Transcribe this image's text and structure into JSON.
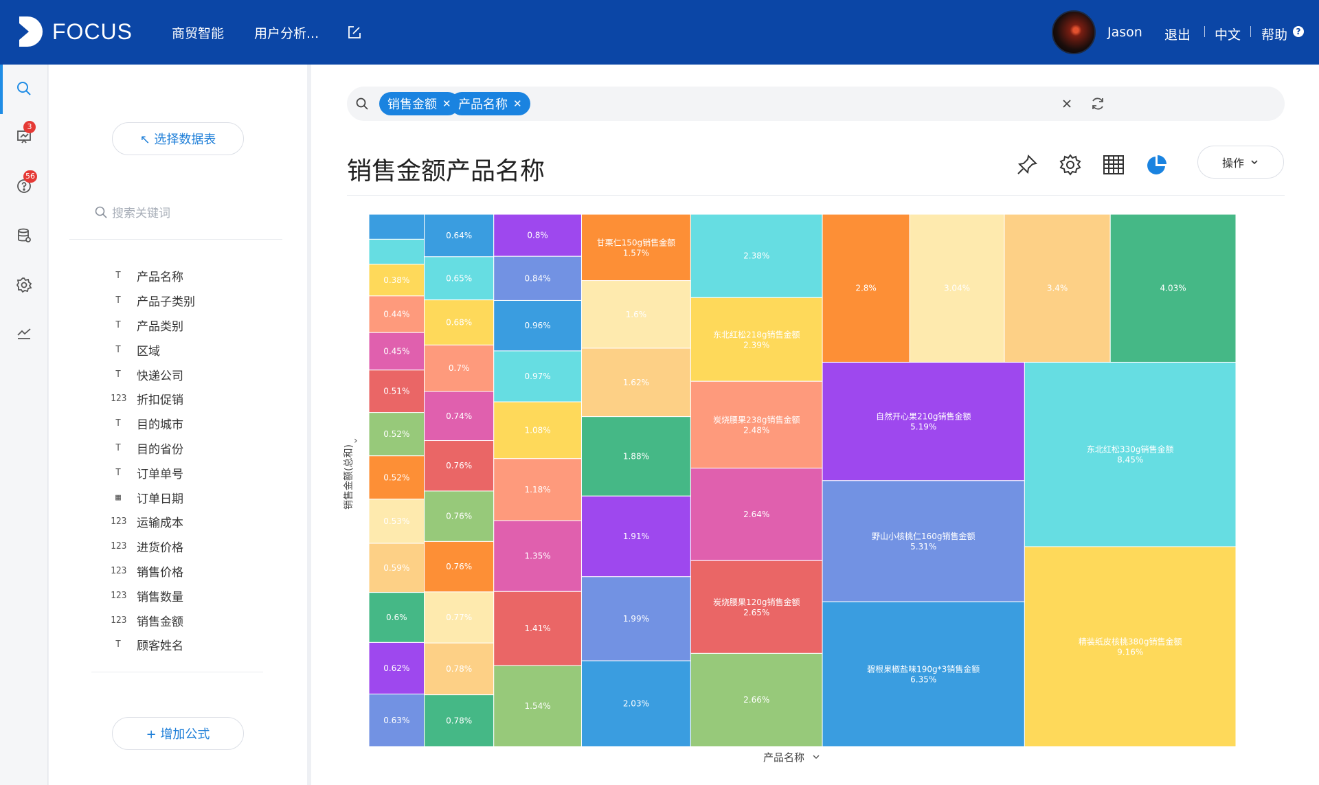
{
  "app": {
    "brand": "FOCUS"
  },
  "nav": {
    "items": [
      "商贸智能",
      "用户分析..."
    ]
  },
  "user": {
    "name": "Jason",
    "logout": "退出",
    "language": "中文",
    "help": "帮助"
  },
  "rail": {
    "badges": {
      "reports": "3",
      "questions": "56"
    }
  },
  "panel": {
    "select_table": "↖ 选择数据表",
    "search_placeholder": "搜索关键词",
    "add_formula": "+ 增加公式",
    "fields": [
      {
        "name": "产品名称",
        "type": "text"
      },
      {
        "name": "产品子类别",
        "type": "text"
      },
      {
        "name": "产品类别",
        "type": "text"
      },
      {
        "name": "区域",
        "type": "text"
      },
      {
        "name": "快递公司",
        "type": "text"
      },
      {
        "name": "折扣促销",
        "type": "number"
      },
      {
        "name": "目的城市",
        "type": "text"
      },
      {
        "name": "目的省份",
        "type": "text"
      },
      {
        "name": "订单单号",
        "type": "text"
      },
      {
        "name": "订单日期",
        "type": "date"
      },
      {
        "name": "运输成本",
        "type": "number"
      },
      {
        "name": "进货价格",
        "type": "number"
      },
      {
        "name": "销售价格",
        "type": "number"
      },
      {
        "name": "销售数量",
        "type": "number"
      },
      {
        "name": "销售金额",
        "type": "number"
      },
      {
        "name": "顾客姓名",
        "type": "text"
      }
    ]
  },
  "search": {
    "tokens": [
      "销售金额",
      "产品名称"
    ]
  },
  "main": {
    "title": "销售金额产品名称",
    "ops_label": "操作"
  },
  "chart_data": {
    "type": "treemap",
    "ylabel": "销售金额(总和)",
    "xlabel": "产品名称",
    "columns": [
      {
        "items": [
          {
            "label": "",
            "value": "",
            "color": "#3a9de0"
          },
          {
            "label": "",
            "value": "",
            "color": "#66dde2"
          },
          {
            "label": "",
            "value": "0.38%",
            "color": "#fed95a"
          },
          {
            "label": "",
            "value": "0.44%",
            "color": "#fe9a7c"
          },
          {
            "label": "",
            "value": "0.45%",
            "color": "#e060ae"
          },
          {
            "label": "",
            "value": "0.51%",
            "color": "#ea6666"
          },
          {
            "label": "",
            "value": "0.52%",
            "color": "#97c97a"
          },
          {
            "label": "",
            "value": "0.52%",
            "color": "#fd8f36"
          },
          {
            "label": "",
            "value": "0.53%",
            "color": "#feeaae"
          },
          {
            "label": "",
            "value": "0.59%",
            "color": "#fdd086"
          },
          {
            "label": "",
            "value": "0.6%",
            "color": "#45b886"
          },
          {
            "label": "",
            "value": "0.62%",
            "color": "#9e48ee"
          },
          {
            "label": "",
            "value": "0.63%",
            "color": "#7292e3"
          }
        ]
      },
      {
        "items": [
          {
            "label": "",
            "value": "0.64%",
            "color": "#3a9de0"
          },
          {
            "label": "",
            "value": "0.65%",
            "color": "#66dde2"
          },
          {
            "label": "",
            "value": "0.68%",
            "color": "#fed95a"
          },
          {
            "label": "",
            "value": "0.7%",
            "color": "#fe9a7c"
          },
          {
            "label": "",
            "value": "0.74%",
            "color": "#e060ae"
          },
          {
            "label": "",
            "value": "0.76%",
            "color": "#ea6666"
          },
          {
            "label": "",
            "value": "0.76%",
            "color": "#97c97a"
          },
          {
            "label": "",
            "value": "0.76%",
            "color": "#fd8f36"
          },
          {
            "label": "",
            "value": "0.77%",
            "color": "#feeaae"
          },
          {
            "label": "",
            "value": "0.78%",
            "color": "#fdd086"
          },
          {
            "label": "",
            "value": "0.78%",
            "color": "#45b886"
          }
        ]
      },
      {
        "items": [
          {
            "label": "",
            "value": "0.8%",
            "color": "#9e48ee"
          },
          {
            "label": "",
            "value": "0.84%",
            "color": "#7292e3"
          },
          {
            "label": "",
            "value": "0.96%",
            "color": "#3a9de0"
          },
          {
            "label": "",
            "value": "0.97%",
            "color": "#66dde2"
          },
          {
            "label": "",
            "value": "1.08%",
            "color": "#fed95a"
          },
          {
            "label": "",
            "value": "1.18%",
            "color": "#fe9a7c"
          },
          {
            "label": "",
            "value": "1.35%",
            "color": "#e060ae"
          },
          {
            "label": "",
            "value": "1.41%",
            "color": "#ea6666"
          },
          {
            "label": "",
            "value": "1.54%",
            "color": "#97c97a"
          }
        ]
      },
      {
        "items": [
          {
            "label": "甘栗仁150g销售金额",
            "value": "1.57%",
            "color": "#fd8f36"
          },
          {
            "label": "",
            "value": "1.6%",
            "color": "#feeaae"
          },
          {
            "label": "",
            "value": "1.62%",
            "color": "#fdd086"
          },
          {
            "label": "",
            "value": "1.88%",
            "color": "#45b886"
          },
          {
            "label": "",
            "value": "1.91%",
            "color": "#9e48ee"
          },
          {
            "label": "",
            "value": "1.99%",
            "color": "#7292e3"
          },
          {
            "label": "",
            "value": "2.03%",
            "color": "#3a9de0"
          }
        ]
      },
      {
        "items": [
          {
            "label": "",
            "value": "2.38%",
            "color": "#66dde2"
          },
          {
            "label": "东北红松218g销售金额",
            "value": "2.39%",
            "color": "#fed95a"
          },
          {
            "label": "炭烧腰果238g销售金额",
            "value": "2.48%",
            "color": "#fe9a7c"
          },
          {
            "label": "",
            "value": "2.64%",
            "color": "#e060ae"
          },
          {
            "label": "炭烧腰果120g销售金额",
            "value": "2.65%",
            "color": "#ea6666"
          },
          {
            "label": "",
            "value": "2.66%",
            "color": "#97c97a"
          }
        ]
      }
    ],
    "top_row": [
      {
        "label": "",
        "value": "2.8%",
        "color": "#fd8f36"
      },
      {
        "label": "",
        "value": "3.04%",
        "color": "#feeaae"
      },
      {
        "label": "",
        "value": "3.4%",
        "color": "#fdd086"
      },
      {
        "label": "",
        "value": "4.03%",
        "color": "#45b886"
      }
    ],
    "mid_column": [
      {
        "label": "自然开心果210g销售金额",
        "value": "5.19%",
        "color": "#9e48ee"
      },
      {
        "label": "野山小核桃仁160g销售金额",
        "value": "5.31%",
        "color": "#7292e3"
      },
      {
        "label": "碧根果椒盐味190g*3销售金额",
        "value": "6.35%",
        "color": "#3a9de0"
      }
    ],
    "right_column": [
      {
        "label": "东北红松330g销售金额",
        "value": "8.45%",
        "color": "#66dde2"
      },
      {
        "label": "精装纸皮核桃380g销售金额",
        "value": "9.16%",
        "color": "#fed95a"
      }
    ]
  }
}
